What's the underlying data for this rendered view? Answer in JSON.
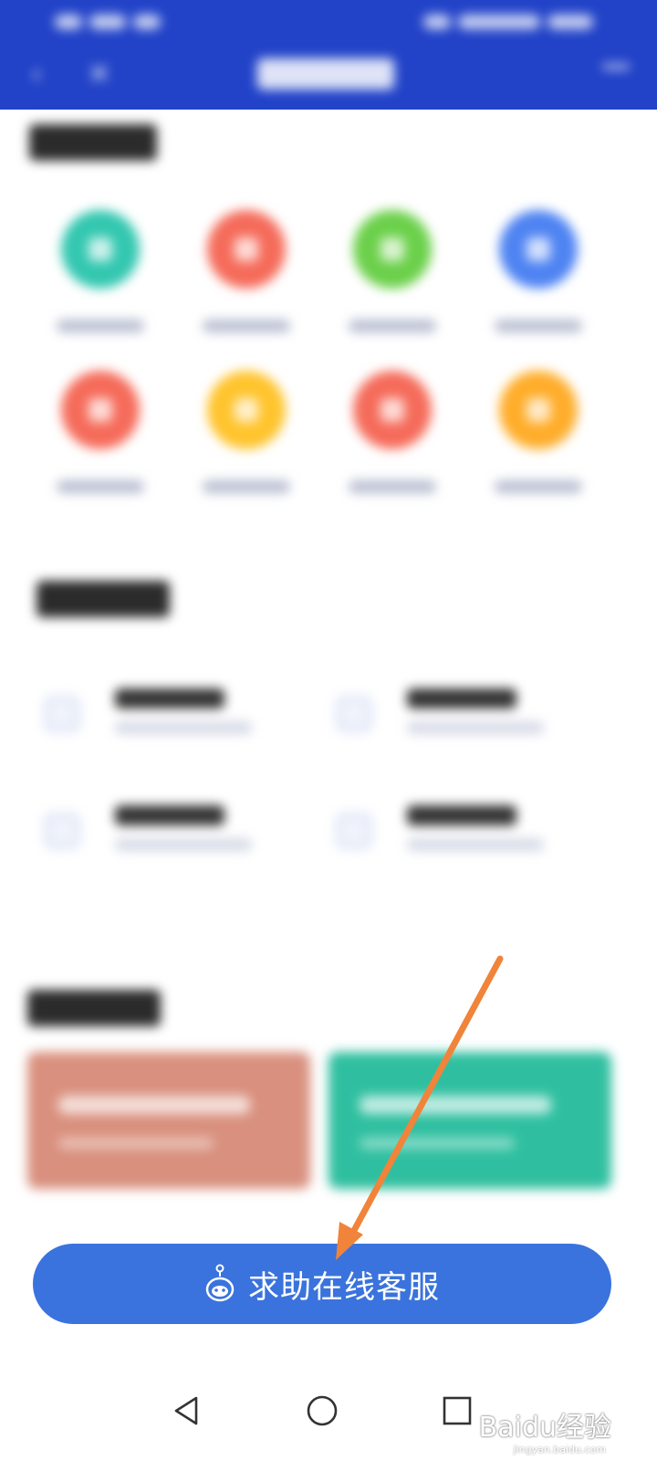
{
  "help_button": {
    "label": "求助在线客服",
    "icon": "robot-icon"
  },
  "watermark": {
    "brand": "Baidu经验",
    "url": "jingyan.baidu.com"
  },
  "nav": {
    "back_icon": "triangle-back-icon",
    "home_icon": "circle-home-icon",
    "recent_icon": "square-recent-icon"
  },
  "colors": {
    "header": "#2243c8",
    "button": "#3a73dd",
    "arrow": "#f0843a",
    "service_icons": [
      "#33c7b0",
      "#f56b5a",
      "#6bd04a",
      "#4e83f2",
      "#f56b5a",
      "#ffc42d",
      "#f56b5a",
      "#ffad2a"
    ],
    "guide_left": "#d9907e",
    "guide_right": "#2fbfa0"
  }
}
